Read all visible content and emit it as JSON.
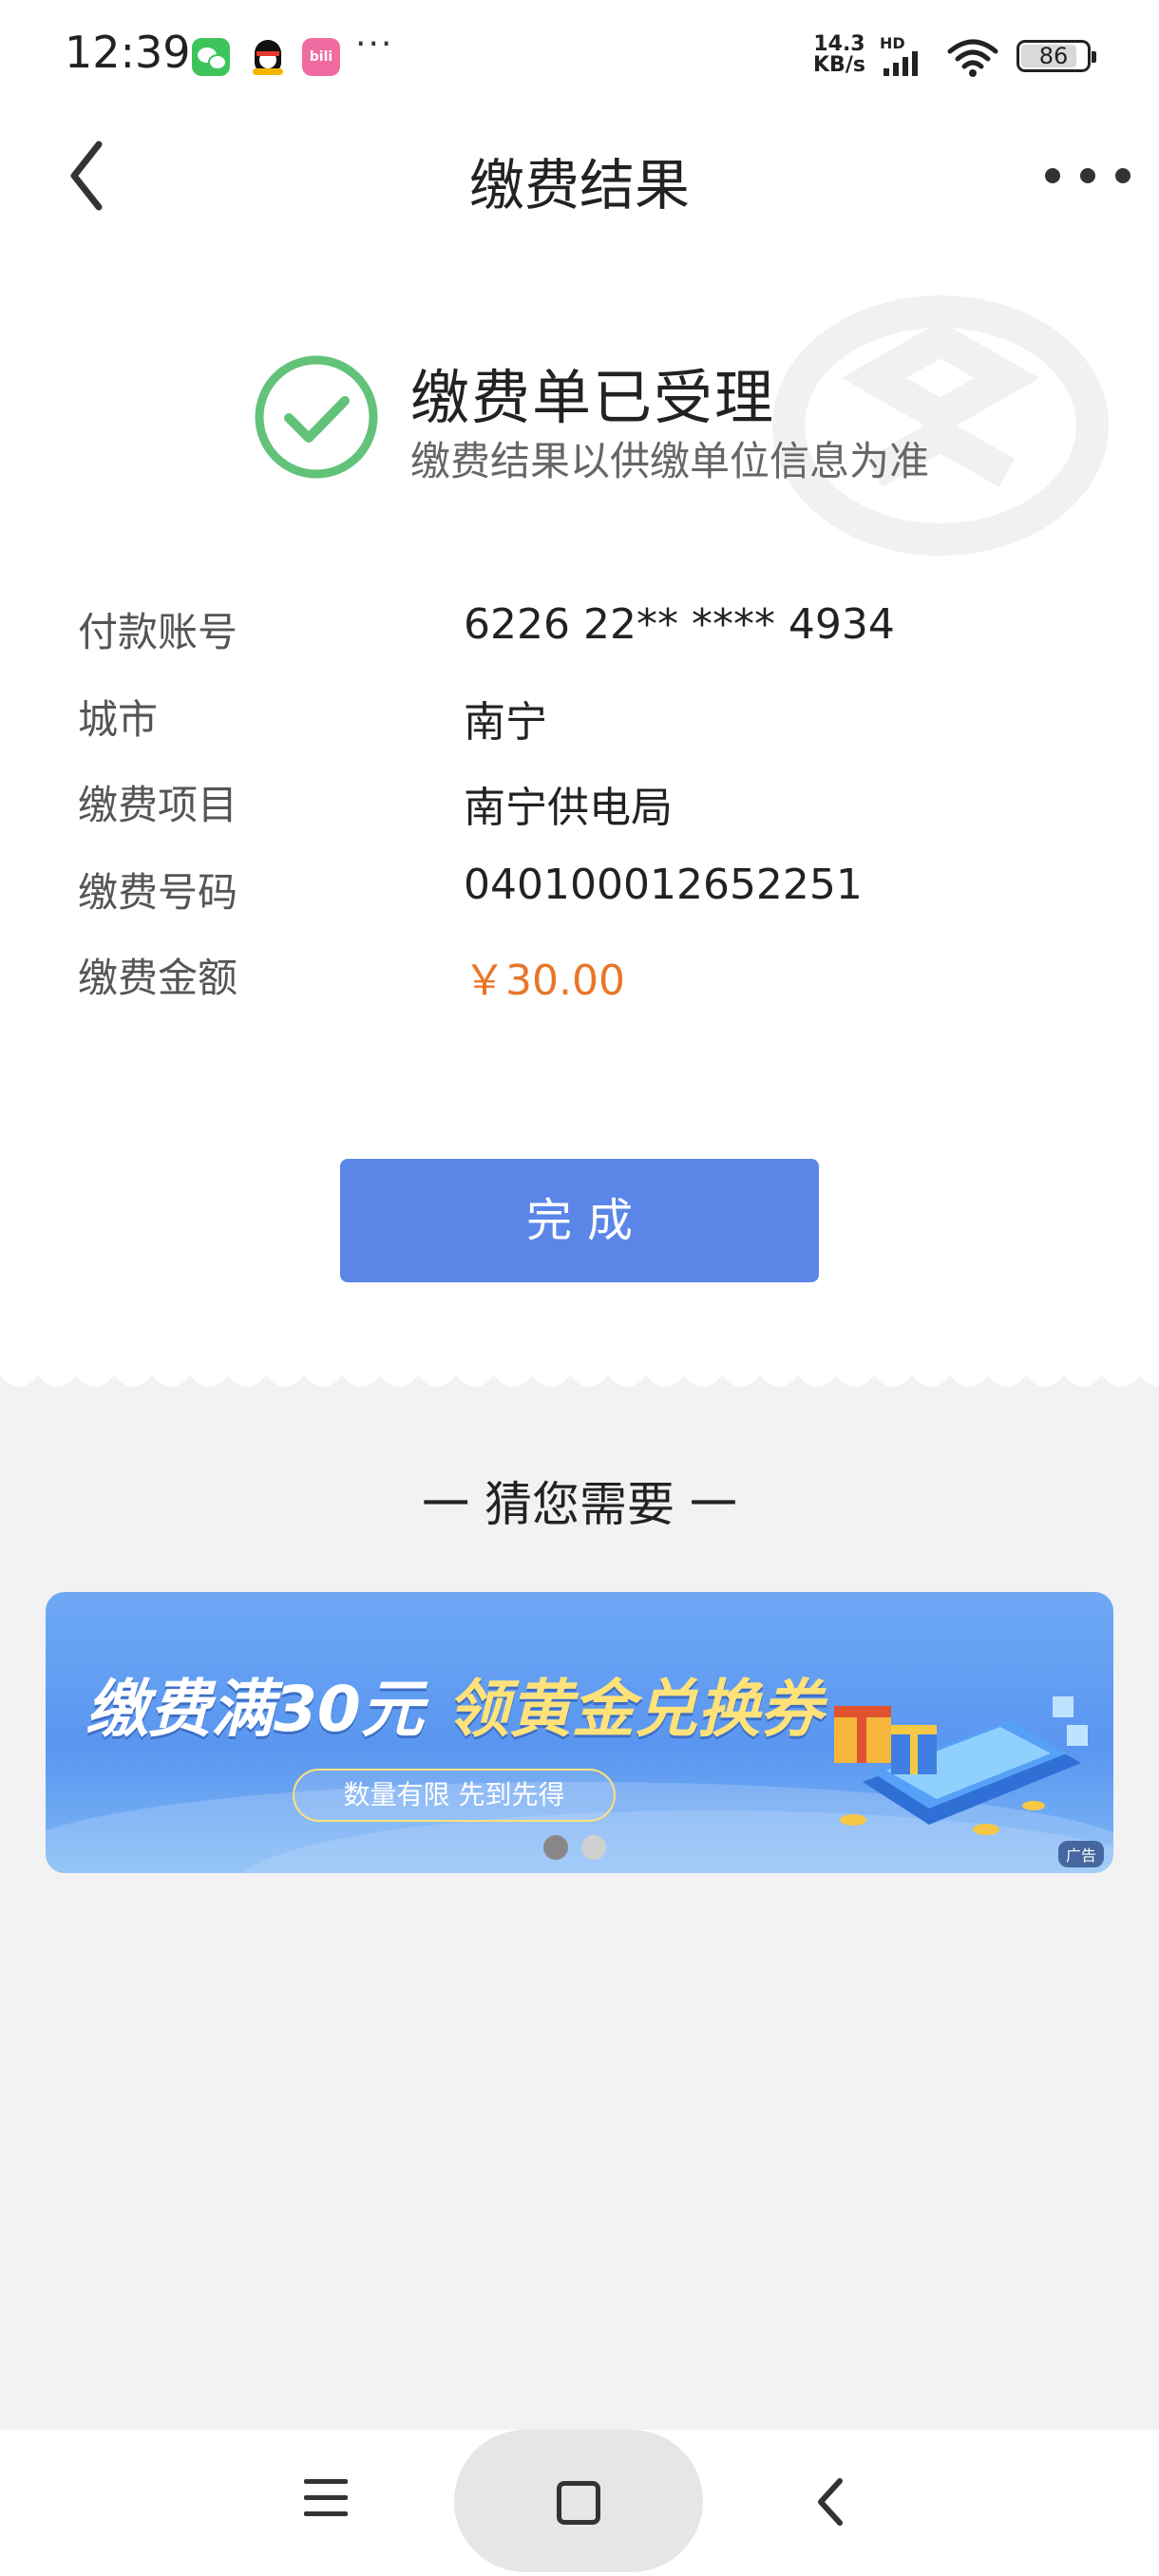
{
  "status_bar": {
    "time": "12:39",
    "more": "···",
    "net_speed_value": "14.3",
    "net_speed_unit": "KB/s",
    "network_type": "HD",
    "battery": "86",
    "battery_level_percent": 86,
    "app_icons": [
      "wechat-icon",
      "qq-icon",
      "bilibili-icon"
    ],
    "bilibili_text": "bili"
  },
  "header": {
    "title": "缴费结果"
  },
  "result": {
    "title": "缴费单已受理",
    "subtitle": "缴费结果以供缴单位信息为准",
    "status_color": "#63c27a"
  },
  "details": [
    {
      "label": "付款账号",
      "value": "6226 22** **** 4934"
    },
    {
      "label": "城市",
      "value": "南宁"
    },
    {
      "label": "缴费项目",
      "value": "南宁供电局"
    },
    {
      "label": "缴费号码",
      "value": "040100012652251"
    },
    {
      "label": "缴费金额",
      "value": "￥30.00"
    }
  ],
  "done_button": {
    "label": "完成",
    "color": "#5b86e8"
  },
  "recommend": {
    "title": "一 猜您需要 一",
    "banner": {
      "headline": "缴费满30元",
      "headline_gold": "领黄金兑换券",
      "pill": "数量有限 先到先得",
      "ad_label": "广告"
    },
    "carousel_total": 2,
    "carousel_active": 1
  },
  "colors": {
    "amount": "#e8762a",
    "accent": "#5b86e8"
  }
}
